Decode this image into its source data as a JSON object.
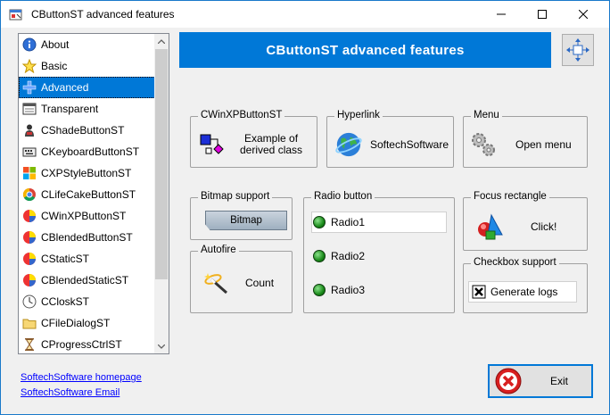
{
  "window": {
    "title": "CButtonST advanced features"
  },
  "list": {
    "items": [
      {
        "label": "About",
        "icon": "info-icon"
      },
      {
        "label": "Basic",
        "icon": "star-icon"
      },
      {
        "label": "Advanced",
        "icon": "plus-icon"
      },
      {
        "label": "Transparent",
        "icon": "window-icon"
      },
      {
        "label": "CShadeButtonST",
        "icon": "person-icon"
      },
      {
        "label": "CKeyboardButtonST",
        "icon": "keyboard-icon"
      },
      {
        "label": "CXPStyleButtonST",
        "icon": "xp-icon"
      },
      {
        "label": "CLifeCakeButtonST",
        "icon": "chrome-icon"
      },
      {
        "label": "CWinXPButtonST",
        "icon": "ball-icon"
      },
      {
        "label": "CBlendedButtonST",
        "icon": "ball-icon"
      },
      {
        "label": "CStaticST",
        "icon": "ball-icon"
      },
      {
        "label": "CBlendedStaticST",
        "icon": "ball-icon"
      },
      {
        "label": "CCloskST",
        "icon": "clock-icon"
      },
      {
        "label": "CFileDialogST",
        "icon": "folder-icon"
      },
      {
        "label": "CProgressCtrlST",
        "icon": "hourglass-icon"
      }
    ],
    "selected": "Advanced"
  },
  "links": {
    "homepage": "SoftechSoftware homepage",
    "email": "SoftechSoftware Email"
  },
  "header": {
    "title": "CButtonST advanced features"
  },
  "groups": {
    "winxp": {
      "title": "CWinXPButtonST",
      "button_line1": "Example of",
      "button_line2": "derived class"
    },
    "hyperlink": {
      "title": "Hyperlink",
      "button": "SoftechSoftware"
    },
    "menu": {
      "title": "Menu",
      "button": "Open menu"
    },
    "bitmap": {
      "title": "Bitmap support",
      "button": "Bitmap"
    },
    "radio": {
      "title": "Radio button",
      "options": [
        "Radio1",
        "Radio2",
        "Radio3"
      ]
    },
    "focus": {
      "title": "Focus rectangle",
      "button": "Click!"
    },
    "autofire": {
      "title": "Autofire",
      "button": "Count"
    },
    "checkbox": {
      "title": "Checkbox support",
      "button": "Generate logs"
    }
  },
  "exit": {
    "label": "Exit"
  },
  "colors": {
    "accent": "#0078d7",
    "link": "#0000ff"
  }
}
